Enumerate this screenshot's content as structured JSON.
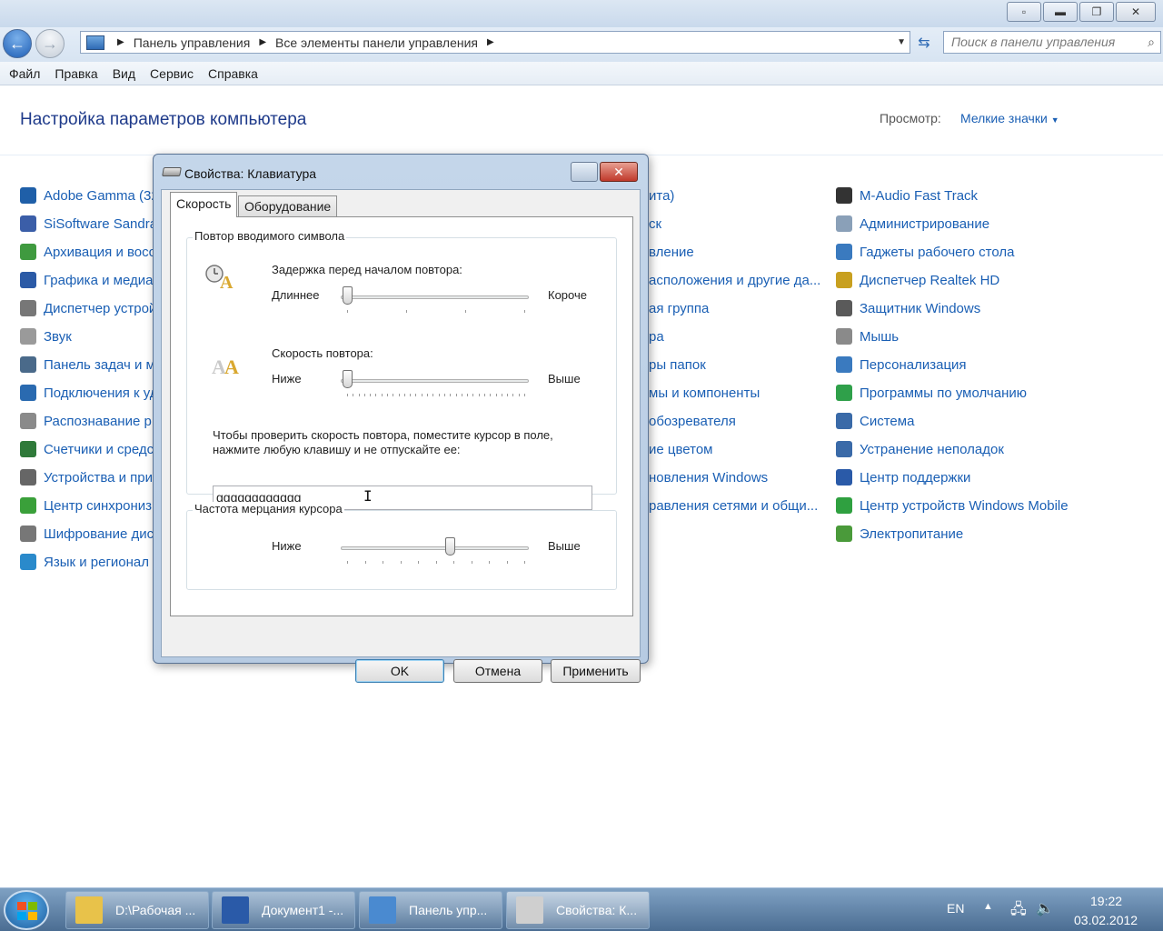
{
  "window": {
    "caption_buttons": [
      "help",
      "minimize",
      "maximize",
      "close"
    ]
  },
  "address_bar": {
    "crumbs": [
      "Панель управления",
      "Все элементы панели управления"
    ],
    "search_placeholder": "Поиск в панели управления"
  },
  "menu": [
    "Файл",
    "Правка",
    "Вид",
    "Сервис",
    "Справка"
  ],
  "page": {
    "heading": "Настройка параметров компьютера",
    "view_label": "Просмотр:",
    "view_value": "Мелкие значки"
  },
  "items_col1": [
    {
      "label": "Adobe Gamma (32",
      "icon": "monitor-icon",
      "color": "#1f5fa8"
    },
    {
      "label": "SiSoftware Sandra",
      "icon": "sandra-icon",
      "color": "#3b5ea8"
    },
    {
      "label": "Архивация и восс",
      "icon": "backup-icon",
      "color": "#3f9a3f"
    },
    {
      "label": "Графика и медиа",
      "icon": "intel-graphics-icon",
      "color": "#2b5aa6"
    },
    {
      "label": "Диспетчер устрой",
      "icon": "device-manager-icon",
      "color": "#777777"
    },
    {
      "label": "Звук",
      "icon": "speaker-icon",
      "color": "#9a9a9a"
    },
    {
      "label": "Панель задач и м",
      "icon": "taskbar-icon",
      "color": "#4a6a8a"
    },
    {
      "label": "Подключения к уд",
      "icon": "remote-icon",
      "color": "#2a6ab0"
    },
    {
      "label": "Распознавание р",
      "icon": "microphone-icon",
      "color": "#8a8a8a"
    },
    {
      "label": "Счетчики и средс",
      "icon": "performance-icon",
      "color": "#2f7a3a"
    },
    {
      "label": "Устройства и при",
      "icon": "printer-icon",
      "color": "#666666"
    },
    {
      "label": "Центр синхрониз",
      "icon": "sync-icon",
      "color": "#3aa03a"
    },
    {
      "label": "Шифрование дис",
      "icon": "bitlocker-icon",
      "color": "#777777"
    },
    {
      "label": "Язык и регионал",
      "icon": "globe-icon",
      "color": "#2a8acb"
    }
  ],
  "items_col2": [
    {
      "label": "ита)"
    },
    {
      "label": "ск"
    },
    {
      "label": "вление"
    },
    {
      "label": "асположения и другие да..."
    },
    {
      "label": "ая группа"
    },
    {
      "label": "ра"
    },
    {
      "label": "ры папок"
    },
    {
      "label": "мы и компоненты"
    },
    {
      "label": "обозревателя"
    },
    {
      "label": "ие цветом"
    },
    {
      "label": "новления Windows"
    },
    {
      "label": "равления сетями и общи..."
    }
  ],
  "items_col3": [
    {
      "label": "M-Audio Fast Track",
      "icon": "audio-device-icon",
      "color": "#333333"
    },
    {
      "label": "Администрирование",
      "icon": "admin-tools-icon",
      "color": "#8aa0b8"
    },
    {
      "label": "Гаджеты рабочего стола",
      "icon": "gadgets-icon",
      "color": "#3a7abf"
    },
    {
      "label": "Диспетчер Realtek HD",
      "icon": "realtek-icon",
      "color": "#c8a020"
    },
    {
      "label": "Защитник Windows",
      "icon": "defender-icon",
      "color": "#5a5a5a"
    },
    {
      "label": "Мышь",
      "icon": "mouse-icon",
      "color": "#8a8a8a"
    },
    {
      "label": "Персонализация",
      "icon": "personalize-icon",
      "color": "#3a7abf"
    },
    {
      "label": "Программы по умолчанию",
      "icon": "default-programs-icon",
      "color": "#2fa04a"
    },
    {
      "label": "Система",
      "icon": "system-icon",
      "color": "#3a6aa8"
    },
    {
      "label": "Устранение неполадок",
      "icon": "troubleshoot-icon",
      "color": "#3a6aa8"
    },
    {
      "label": "Центр поддержки",
      "icon": "flag-icon",
      "color": "#2a5aa8"
    },
    {
      "label": "Центр устройств Windows Mobile",
      "icon": "mobile-center-icon",
      "color": "#2fa040"
    },
    {
      "label": "Электропитание",
      "icon": "power-icon",
      "color": "#4a9a3a"
    }
  ],
  "dialog": {
    "title": "Свойства: Клавиатура",
    "tabs": [
      "Скорость",
      "Оборудование"
    ],
    "group_repeat": "Повтор вводимого символа",
    "delay_label": "Задержка перед началом повтора:",
    "delay_min": "Длиннее",
    "delay_max": "Короче",
    "delay_level": 0.0,
    "rate_label": "Скорость повтора:",
    "rate_min": "Ниже",
    "rate_max": "Выше",
    "rate_level": 0.0,
    "test_hint_1": "Чтобы проверить скорость повтора, поместите курсор в поле,",
    "test_hint_2": "нажмите любую клавишу и не отпускайте ее:",
    "test_value": "gggggggggggg",
    "group_blink": "Частота мерцания курсора",
    "blink_min": "Ниже",
    "blink_max": "Выше",
    "blink_level": 0.6,
    "ok": "OK",
    "cancel": "Отмена",
    "apply": "Применить"
  },
  "taskbar": {
    "buttons": [
      {
        "label": "D:\\Рабочая ...",
        "icon": "folder-icon",
        "color": "#e8c24a"
      },
      {
        "label": "Документ1 -...",
        "icon": "word-icon",
        "color": "#2a5aa8"
      },
      {
        "label": "Панель упр...",
        "icon": "control-panel-icon",
        "color": "#4a8ad0"
      },
      {
        "label": "Свойства: К...",
        "icon": "keyboard-icon",
        "color": "#cfcfcf"
      }
    ],
    "lang": "EN",
    "time": "19:22",
    "date": "03.02.2012"
  }
}
